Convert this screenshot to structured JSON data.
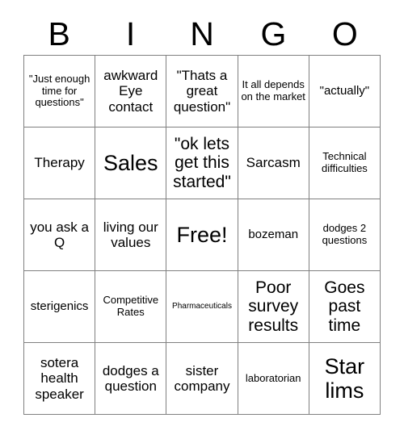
{
  "header": {
    "letters": [
      "B",
      "I",
      "N",
      "G",
      "O"
    ]
  },
  "grid": {
    "rows": [
      [
        {
          "text": "\"Just enough time for questions\"",
          "size": "fs-sm"
        },
        {
          "text": "awkward Eye contact",
          "size": "fs-lg"
        },
        {
          "text": "\"Thats a great question\"",
          "size": "fs-lg"
        },
        {
          "text": "It all depends on the market",
          "size": "fs-sm"
        },
        {
          "text": "\"actually\"",
          "size": "fs-md"
        }
      ],
      [
        {
          "text": "Therapy",
          "size": "fs-lg"
        },
        {
          "text": "Sales",
          "size": "fs-xxl"
        },
        {
          "text": "\"ok lets get this started\"",
          "size": "fs-xl"
        },
        {
          "text": "Sarcasm",
          "size": "fs-lg"
        },
        {
          "text": "Technical difficulties",
          "size": "fs-sm"
        }
      ],
      [
        {
          "text": "you ask a Q",
          "size": "fs-lg"
        },
        {
          "text": "living our values",
          "size": "fs-lg"
        },
        {
          "text": "Free!",
          "size": "fs-xxl"
        },
        {
          "text": "bozeman",
          "size": "fs-md"
        },
        {
          "text": "dodges 2 questions",
          "size": "fs-sm"
        }
      ],
      [
        {
          "text": "sterigenics",
          "size": "fs-md"
        },
        {
          "text": "Competitive Rates",
          "size": "fs-sm"
        },
        {
          "text": "Pharmaceuticals",
          "size": "fs-xs"
        },
        {
          "text": "Poor survey results",
          "size": "fs-xl"
        },
        {
          "text": "Goes past time",
          "size": "fs-xl"
        }
      ],
      [
        {
          "text": "sotera health speaker",
          "size": "fs-lg"
        },
        {
          "text": "dodges a question",
          "size": "fs-lg"
        },
        {
          "text": "sister company",
          "size": "fs-lg"
        },
        {
          "text": "laboratorian",
          "size": "fs-sm"
        },
        {
          "text": "Star lims",
          "size": "fs-xxl"
        }
      ]
    ]
  },
  "colors": {
    "background": "#ffffff",
    "text": "#000000",
    "border": "#808080"
  }
}
